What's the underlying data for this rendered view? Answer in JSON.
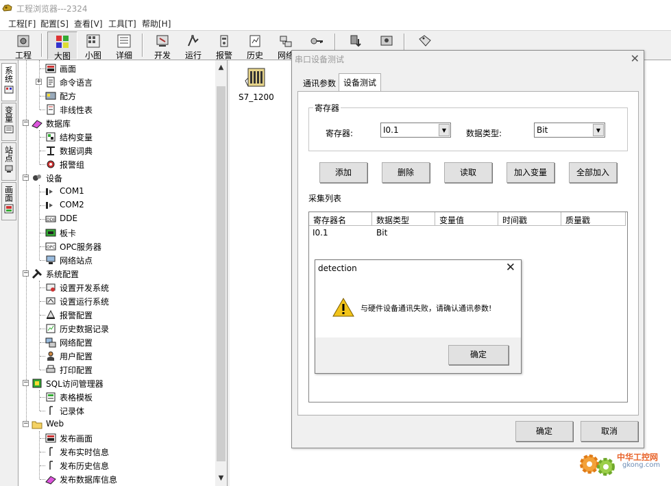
{
  "window": {
    "title": "工程浏览器---2324"
  },
  "menu": [
    "工程[F]",
    "配置[S]",
    "查看[V]",
    "工具[T]",
    "帮助[H]"
  ],
  "toolbar": {
    "buttons": [
      "工程",
      "大图",
      "小图",
      "详细",
      "开发",
      "运行",
      "报警",
      "历史",
      "网络",
      "",
      "",
      "",
      ""
    ],
    "active": "大图"
  },
  "side_tabs": [
    "系统",
    "变量",
    "站点",
    "画面"
  ],
  "tree": {
    "items": [
      {
        "label": "画面",
        "icon": "screen-icon"
      },
      {
        "label": "命令语言",
        "icon": "script-icon",
        "expander": "+"
      },
      {
        "label": "配方",
        "icon": "recipe-icon"
      },
      {
        "label": "非线性表",
        "icon": "table-icon"
      },
      {
        "label": "数据库",
        "icon": "database-icon",
        "expander": "−"
      },
      {
        "label": "结构变量",
        "icon": "struct-icon"
      },
      {
        "label": "数据词典",
        "icon": "dictionary-icon"
      },
      {
        "label": "报警组",
        "icon": "alarm-group-icon"
      },
      {
        "label": "设备",
        "icon": "device-icon",
        "expander": "−"
      },
      {
        "label": "COM1",
        "icon": "serial-port-icon"
      },
      {
        "label": "COM2",
        "icon": "serial-port-icon"
      },
      {
        "label": "DDE",
        "icon": "dde-icon"
      },
      {
        "label": "板卡",
        "icon": "board-icon"
      },
      {
        "label": "OPC服务器",
        "icon": "opc-icon"
      },
      {
        "label": "网络站点",
        "icon": "network-station-icon"
      },
      {
        "label": "系统配置",
        "icon": "tools-icon",
        "expander": "−"
      },
      {
        "label": "设置开发系统",
        "icon": "dev-settings-icon"
      },
      {
        "label": "设置运行系统",
        "icon": "run-settings-icon"
      },
      {
        "label": "报警配置",
        "icon": "alarm-config-icon"
      },
      {
        "label": "历史数据记录",
        "icon": "history-icon"
      },
      {
        "label": "网络配置",
        "icon": "network-config-icon"
      },
      {
        "label": "用户配置",
        "icon": "user-icon"
      },
      {
        "label": "打印配置",
        "icon": "print-icon"
      },
      {
        "label": "SQL访问管理器",
        "icon": "sql-icon",
        "expander": "−"
      },
      {
        "label": "表格模板",
        "icon": "template-icon"
      },
      {
        "label": "记录体",
        "icon": "record-icon"
      },
      {
        "label": "Web",
        "icon": "folder-icon",
        "expander": "−"
      },
      {
        "label": "发布画面",
        "icon": "publish-screen-icon"
      },
      {
        "label": "发布实时信息",
        "icon": "publish-realtime-icon"
      },
      {
        "label": "发布历史信息",
        "icon": "publish-history-icon"
      },
      {
        "label": "发布数据库信息",
        "icon": "publish-db-icon"
      }
    ]
  },
  "main": {
    "device_label": "S7_1200"
  },
  "serial_dialog": {
    "title": "串口设备测试",
    "tabs": [
      "通讯参数",
      "设备测试"
    ],
    "active_tab": "设备测试",
    "group_title": "寄存器",
    "register_label": "寄存器:",
    "register_value": "I0.1",
    "datatype_label": "数据类型:",
    "datatype_value": "Bit",
    "buttons": [
      "添加",
      "删除",
      "读取",
      "加入变量",
      "全部加入"
    ],
    "list_title": "采集列表",
    "columns": [
      "寄存器名",
      "数据类型",
      "变量值",
      "时间戳",
      "质量戳"
    ],
    "rows": [
      [
        "I0.1",
        "Bit",
        "",
        "",
        ""
      ]
    ],
    "ok": "确定",
    "cancel": "取消"
  },
  "detection_dialog": {
    "title": "detection",
    "message": "与硬件设备通讯失败，请确认通讯参数!",
    "ok": "确定",
    "icon": "warning-icon"
  },
  "watermark": {
    "brand": "中华工控网",
    "domain": "gkong.com"
  },
  "colors": {
    "window_bg": "#f0f0f0",
    "title_text": "#9a9a9a",
    "watermark": "#e8632a"
  }
}
